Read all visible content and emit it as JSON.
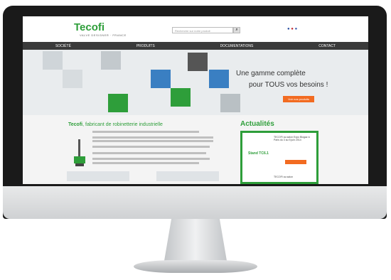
{
  "site": {
    "logo": "Tecofi",
    "tagline": "VALVE DESIGNER · FRANCE",
    "search_placeholder": "Recherche sur notre produit",
    "nav": [
      "SOCIÉTÉ",
      "PRODUITS",
      "DOCUMENTATIONS",
      "CONTACT"
    ],
    "hero_line1": "Une gamme complète",
    "hero_line2": "pour TOUS vos besoins !",
    "hero_button": "Voir nos produits",
    "title_brand": "Tecofi",
    "title_rest": ", fabricant de robinetterie industrielle",
    "news_title": "Actualités",
    "news_item1": "TECOFI au salon Expo Biogaz à Paris du 3 au 5 juin 2014",
    "news_item2": "Stand TC6.1",
    "news_item3": "TECOFI au salon"
  },
  "colors": {
    "brand": "#2e9e3a",
    "accent": "#f26b21",
    "nav": "#3a3a3a"
  }
}
